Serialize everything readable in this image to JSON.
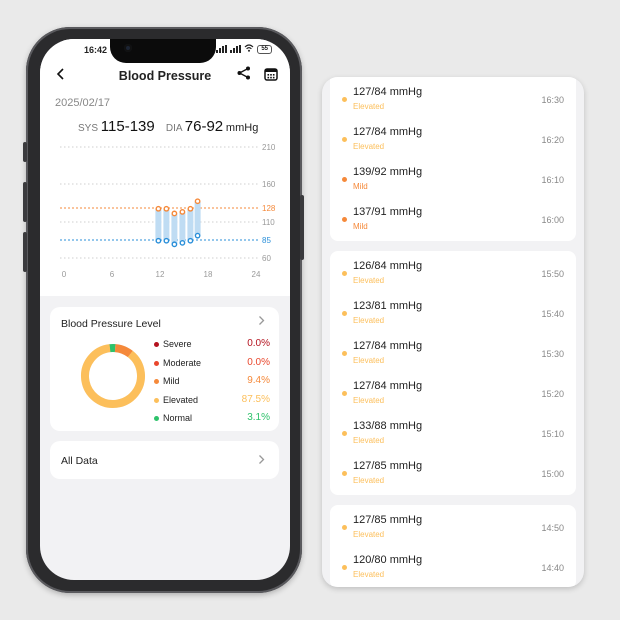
{
  "status_bar": {
    "time": "16:42",
    "battery": "55"
  },
  "header": {
    "title": "Blood Pressure"
  },
  "summary": {
    "date": "2025/02/17",
    "sys_label": "SYS",
    "sys_range": "115-139",
    "dia_label": "DIA",
    "dia_range": "76-92",
    "unit": "mmHg"
  },
  "chart_data": {
    "type": "range-bar",
    "y_ticks": [
      "210",
      "160",
      "128",
      "110",
      "85",
      "60"
    ],
    "x_ticks": [
      "0",
      "6",
      "12",
      "18",
      "24"
    ],
    "sys_reference": 128,
    "dia_reference": 85,
    "ylim": [
      60,
      210
    ],
    "xlim": [
      0,
      24
    ],
    "points": [
      {
        "x": 11.8,
        "sys": 127,
        "dia": 84
      },
      {
        "x": 12.8,
        "sys": 127,
        "dia": 84
      },
      {
        "x": 13.8,
        "sys": 121,
        "dia": 79
      },
      {
        "x": 14.8,
        "sys": 123,
        "dia": 81
      },
      {
        "x": 15.8,
        "sys": 127,
        "dia": 84
      },
      {
        "x": 16.7,
        "sys": 137,
        "dia": 91
      }
    ],
    "colors": {
      "sys": "#f5893a",
      "dia": "#2a8fd9",
      "bar": "#bfdcf3"
    }
  },
  "level": {
    "title": "Blood Pressure Level",
    "items": [
      {
        "name": "Severe",
        "pct": "0.0%",
        "value": 0.0,
        "color": "#b4121e"
      },
      {
        "name": "Moderate",
        "pct": "0.0%",
        "value": 0.0,
        "color": "#e9472d"
      },
      {
        "name": "Mild",
        "pct": "9.4%",
        "value": 9.4,
        "color": "#f5893a"
      },
      {
        "name": "Elevated",
        "pct": "87.5%",
        "value": 87.5,
        "color": "#fcbf5b"
      },
      {
        "name": "Normal",
        "pct": "3.1%",
        "value": 3.1,
        "color": "#2ec26b"
      }
    ]
  },
  "all_data": {
    "label": "All Data"
  },
  "records": {
    "groups": [
      {
        "entries": [
          {
            "value": "127/84 mmHg",
            "category": "Elevated",
            "time": "16:30",
            "color": "#fcbf5b"
          },
          {
            "value": "127/84 mmHg",
            "category": "Elevated",
            "time": "16:20",
            "color": "#fcbf5b"
          },
          {
            "value": "139/92 mmHg",
            "category": "Mild",
            "time": "16:10",
            "color": "#f5893a"
          },
          {
            "value": "137/91 mmHg",
            "category": "Mild",
            "time": "16:00",
            "color": "#f5893a"
          }
        ]
      },
      {
        "entries": [
          {
            "value": "126/84 mmHg",
            "category": "Elevated",
            "time": "15:50",
            "color": "#fcbf5b"
          },
          {
            "value": "123/81 mmHg",
            "category": "Elevated",
            "time": "15:40",
            "color": "#fcbf5b"
          },
          {
            "value": "127/84 mmHg",
            "category": "Elevated",
            "time": "15:30",
            "color": "#fcbf5b"
          },
          {
            "value": "127/84 mmHg",
            "category": "Elevated",
            "time": "15:20",
            "color": "#fcbf5b"
          },
          {
            "value": "133/88 mmHg",
            "category": "Elevated",
            "time": "15:10",
            "color": "#fcbf5b"
          },
          {
            "value": "127/85 mmHg",
            "category": "Elevated",
            "time": "15:00",
            "color": "#fcbf5b"
          }
        ]
      },
      {
        "entries": [
          {
            "value": "127/85 mmHg",
            "category": "Elevated",
            "time": "14:50",
            "color": "#fcbf5b"
          },
          {
            "value": "120/80 mmHg",
            "category": "Elevated",
            "time": "14:40",
            "color": "#fcbf5b"
          }
        ]
      }
    ]
  }
}
